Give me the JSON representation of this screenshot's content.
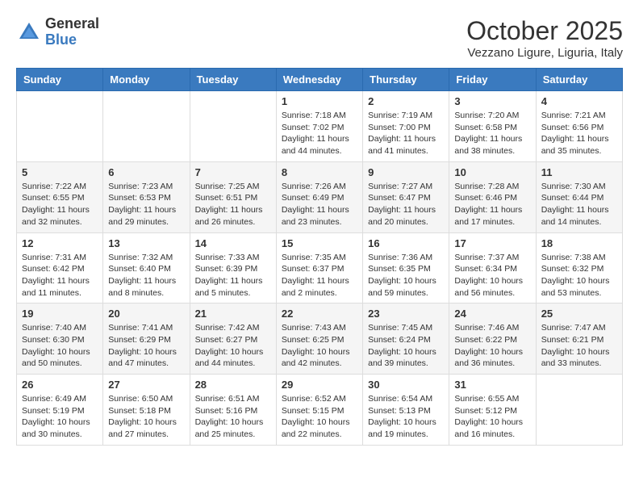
{
  "header": {
    "logo_general": "General",
    "logo_blue": "Blue",
    "month_title": "October 2025",
    "subtitle": "Vezzano Ligure, Liguria, Italy"
  },
  "days_of_week": [
    "Sunday",
    "Monday",
    "Tuesday",
    "Wednesday",
    "Thursday",
    "Friday",
    "Saturday"
  ],
  "weeks": [
    [
      {
        "day": "",
        "info": ""
      },
      {
        "day": "",
        "info": ""
      },
      {
        "day": "",
        "info": ""
      },
      {
        "day": "1",
        "info": "Sunrise: 7:18 AM\nSunset: 7:02 PM\nDaylight: 11 hours and 44 minutes."
      },
      {
        "day": "2",
        "info": "Sunrise: 7:19 AM\nSunset: 7:00 PM\nDaylight: 11 hours and 41 minutes."
      },
      {
        "day": "3",
        "info": "Sunrise: 7:20 AM\nSunset: 6:58 PM\nDaylight: 11 hours and 38 minutes."
      },
      {
        "day": "4",
        "info": "Sunrise: 7:21 AM\nSunset: 6:56 PM\nDaylight: 11 hours and 35 minutes."
      }
    ],
    [
      {
        "day": "5",
        "info": "Sunrise: 7:22 AM\nSunset: 6:55 PM\nDaylight: 11 hours and 32 minutes."
      },
      {
        "day": "6",
        "info": "Sunrise: 7:23 AM\nSunset: 6:53 PM\nDaylight: 11 hours and 29 minutes."
      },
      {
        "day": "7",
        "info": "Sunrise: 7:25 AM\nSunset: 6:51 PM\nDaylight: 11 hours and 26 minutes."
      },
      {
        "day": "8",
        "info": "Sunrise: 7:26 AM\nSunset: 6:49 PM\nDaylight: 11 hours and 23 minutes."
      },
      {
        "day": "9",
        "info": "Sunrise: 7:27 AM\nSunset: 6:47 PM\nDaylight: 11 hours and 20 minutes."
      },
      {
        "day": "10",
        "info": "Sunrise: 7:28 AM\nSunset: 6:46 PM\nDaylight: 11 hours and 17 minutes."
      },
      {
        "day": "11",
        "info": "Sunrise: 7:30 AM\nSunset: 6:44 PM\nDaylight: 11 hours and 14 minutes."
      }
    ],
    [
      {
        "day": "12",
        "info": "Sunrise: 7:31 AM\nSunset: 6:42 PM\nDaylight: 11 hours and 11 minutes."
      },
      {
        "day": "13",
        "info": "Sunrise: 7:32 AM\nSunset: 6:40 PM\nDaylight: 11 hours and 8 minutes."
      },
      {
        "day": "14",
        "info": "Sunrise: 7:33 AM\nSunset: 6:39 PM\nDaylight: 11 hours and 5 minutes."
      },
      {
        "day": "15",
        "info": "Sunrise: 7:35 AM\nSunset: 6:37 PM\nDaylight: 11 hours and 2 minutes."
      },
      {
        "day": "16",
        "info": "Sunrise: 7:36 AM\nSunset: 6:35 PM\nDaylight: 10 hours and 59 minutes."
      },
      {
        "day": "17",
        "info": "Sunrise: 7:37 AM\nSunset: 6:34 PM\nDaylight: 10 hours and 56 minutes."
      },
      {
        "day": "18",
        "info": "Sunrise: 7:38 AM\nSunset: 6:32 PM\nDaylight: 10 hours and 53 minutes."
      }
    ],
    [
      {
        "day": "19",
        "info": "Sunrise: 7:40 AM\nSunset: 6:30 PM\nDaylight: 10 hours and 50 minutes."
      },
      {
        "day": "20",
        "info": "Sunrise: 7:41 AM\nSunset: 6:29 PM\nDaylight: 10 hours and 47 minutes."
      },
      {
        "day": "21",
        "info": "Sunrise: 7:42 AM\nSunset: 6:27 PM\nDaylight: 10 hours and 44 minutes."
      },
      {
        "day": "22",
        "info": "Sunrise: 7:43 AM\nSunset: 6:25 PM\nDaylight: 10 hours and 42 minutes."
      },
      {
        "day": "23",
        "info": "Sunrise: 7:45 AM\nSunset: 6:24 PM\nDaylight: 10 hours and 39 minutes."
      },
      {
        "day": "24",
        "info": "Sunrise: 7:46 AM\nSunset: 6:22 PM\nDaylight: 10 hours and 36 minutes."
      },
      {
        "day": "25",
        "info": "Sunrise: 7:47 AM\nSunset: 6:21 PM\nDaylight: 10 hours and 33 minutes."
      }
    ],
    [
      {
        "day": "26",
        "info": "Sunrise: 6:49 AM\nSunset: 5:19 PM\nDaylight: 10 hours and 30 minutes."
      },
      {
        "day": "27",
        "info": "Sunrise: 6:50 AM\nSunset: 5:18 PM\nDaylight: 10 hours and 27 minutes."
      },
      {
        "day": "28",
        "info": "Sunrise: 6:51 AM\nSunset: 5:16 PM\nDaylight: 10 hours and 25 minutes."
      },
      {
        "day": "29",
        "info": "Sunrise: 6:52 AM\nSunset: 5:15 PM\nDaylight: 10 hours and 22 minutes."
      },
      {
        "day": "30",
        "info": "Sunrise: 6:54 AM\nSunset: 5:13 PM\nDaylight: 10 hours and 19 minutes."
      },
      {
        "day": "31",
        "info": "Sunrise: 6:55 AM\nSunset: 5:12 PM\nDaylight: 10 hours and 16 minutes."
      },
      {
        "day": "",
        "info": ""
      }
    ]
  ]
}
